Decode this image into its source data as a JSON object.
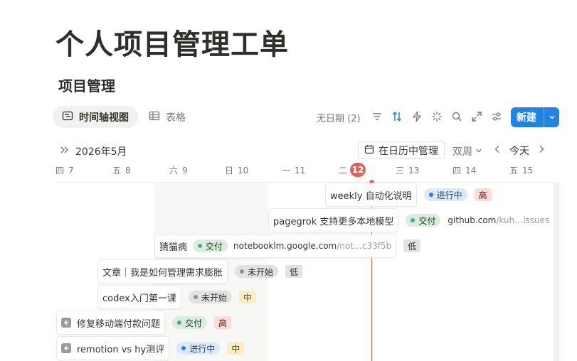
{
  "page": {
    "title": "个人项目管理工单"
  },
  "database": {
    "title": "项目管理"
  },
  "views": [
    {
      "label": "时间轴视图",
      "icon": "timeline-icon",
      "active": true
    },
    {
      "label": "表格",
      "icon": "table-icon",
      "active": false
    }
  ],
  "toolbar": {
    "no_date": "无日期 (2)",
    "new_label": "新建",
    "icons": [
      "filter-icon",
      "sort-icon",
      "automation-icon",
      "sparkle-icon",
      "search-icon",
      "expand-icon",
      "settings-icon"
    ]
  },
  "timeline": {
    "month": "2026年5月",
    "calendar_button": "在日历中管理",
    "period": "双周",
    "today": "今天",
    "days": [
      {
        "dow": "四",
        "num": "7"
      },
      {
        "dow": "五",
        "num": "8"
      },
      {
        "dow": "六",
        "num": "9"
      },
      {
        "dow": "日",
        "num": "10"
      },
      {
        "dow": "一",
        "num": "11"
      },
      {
        "dow": "二",
        "num": "12"
      },
      {
        "dow": "三",
        "num": "13"
      },
      {
        "dow": "四",
        "num": "14"
      },
      {
        "dow": "五",
        "num": "15"
      }
    ]
  },
  "items": [
    {
      "title": "weekly 自动化说明",
      "status": "进行中",
      "priority": "高"
    },
    {
      "title": "pagegrok 支持更多本地模型",
      "status": "交付",
      "link_main": "github.com",
      "link_muted": "/kuh…issues"
    },
    {
      "title": "猜猫病",
      "status": "交付",
      "link_main": "notebooklm.google.com",
      "link_muted": "/not…c33f5b",
      "priority": "低"
    },
    {
      "title": "文章｜我是如何管理需求膨胀",
      "status": "未开始",
      "priority": "低"
    },
    {
      "title": "codex入门第一课",
      "status": "未开始",
      "priority": "中"
    },
    {
      "title": "修复移动端付款问题",
      "status": "交付",
      "priority": "高"
    },
    {
      "title": "remotion vs hy测评",
      "status": "进行中",
      "priority": "中"
    }
  ],
  "colors": {
    "accent": "#2383e2",
    "today": "#e16259",
    "status_progress": "#dbeafa",
    "status_done": "#dbeddb",
    "status_notstart": "#e3e2e0",
    "priority_high": "#fadcd9",
    "priority_mid": "#fbecc7",
    "priority_low": "#e3e2e0"
  }
}
